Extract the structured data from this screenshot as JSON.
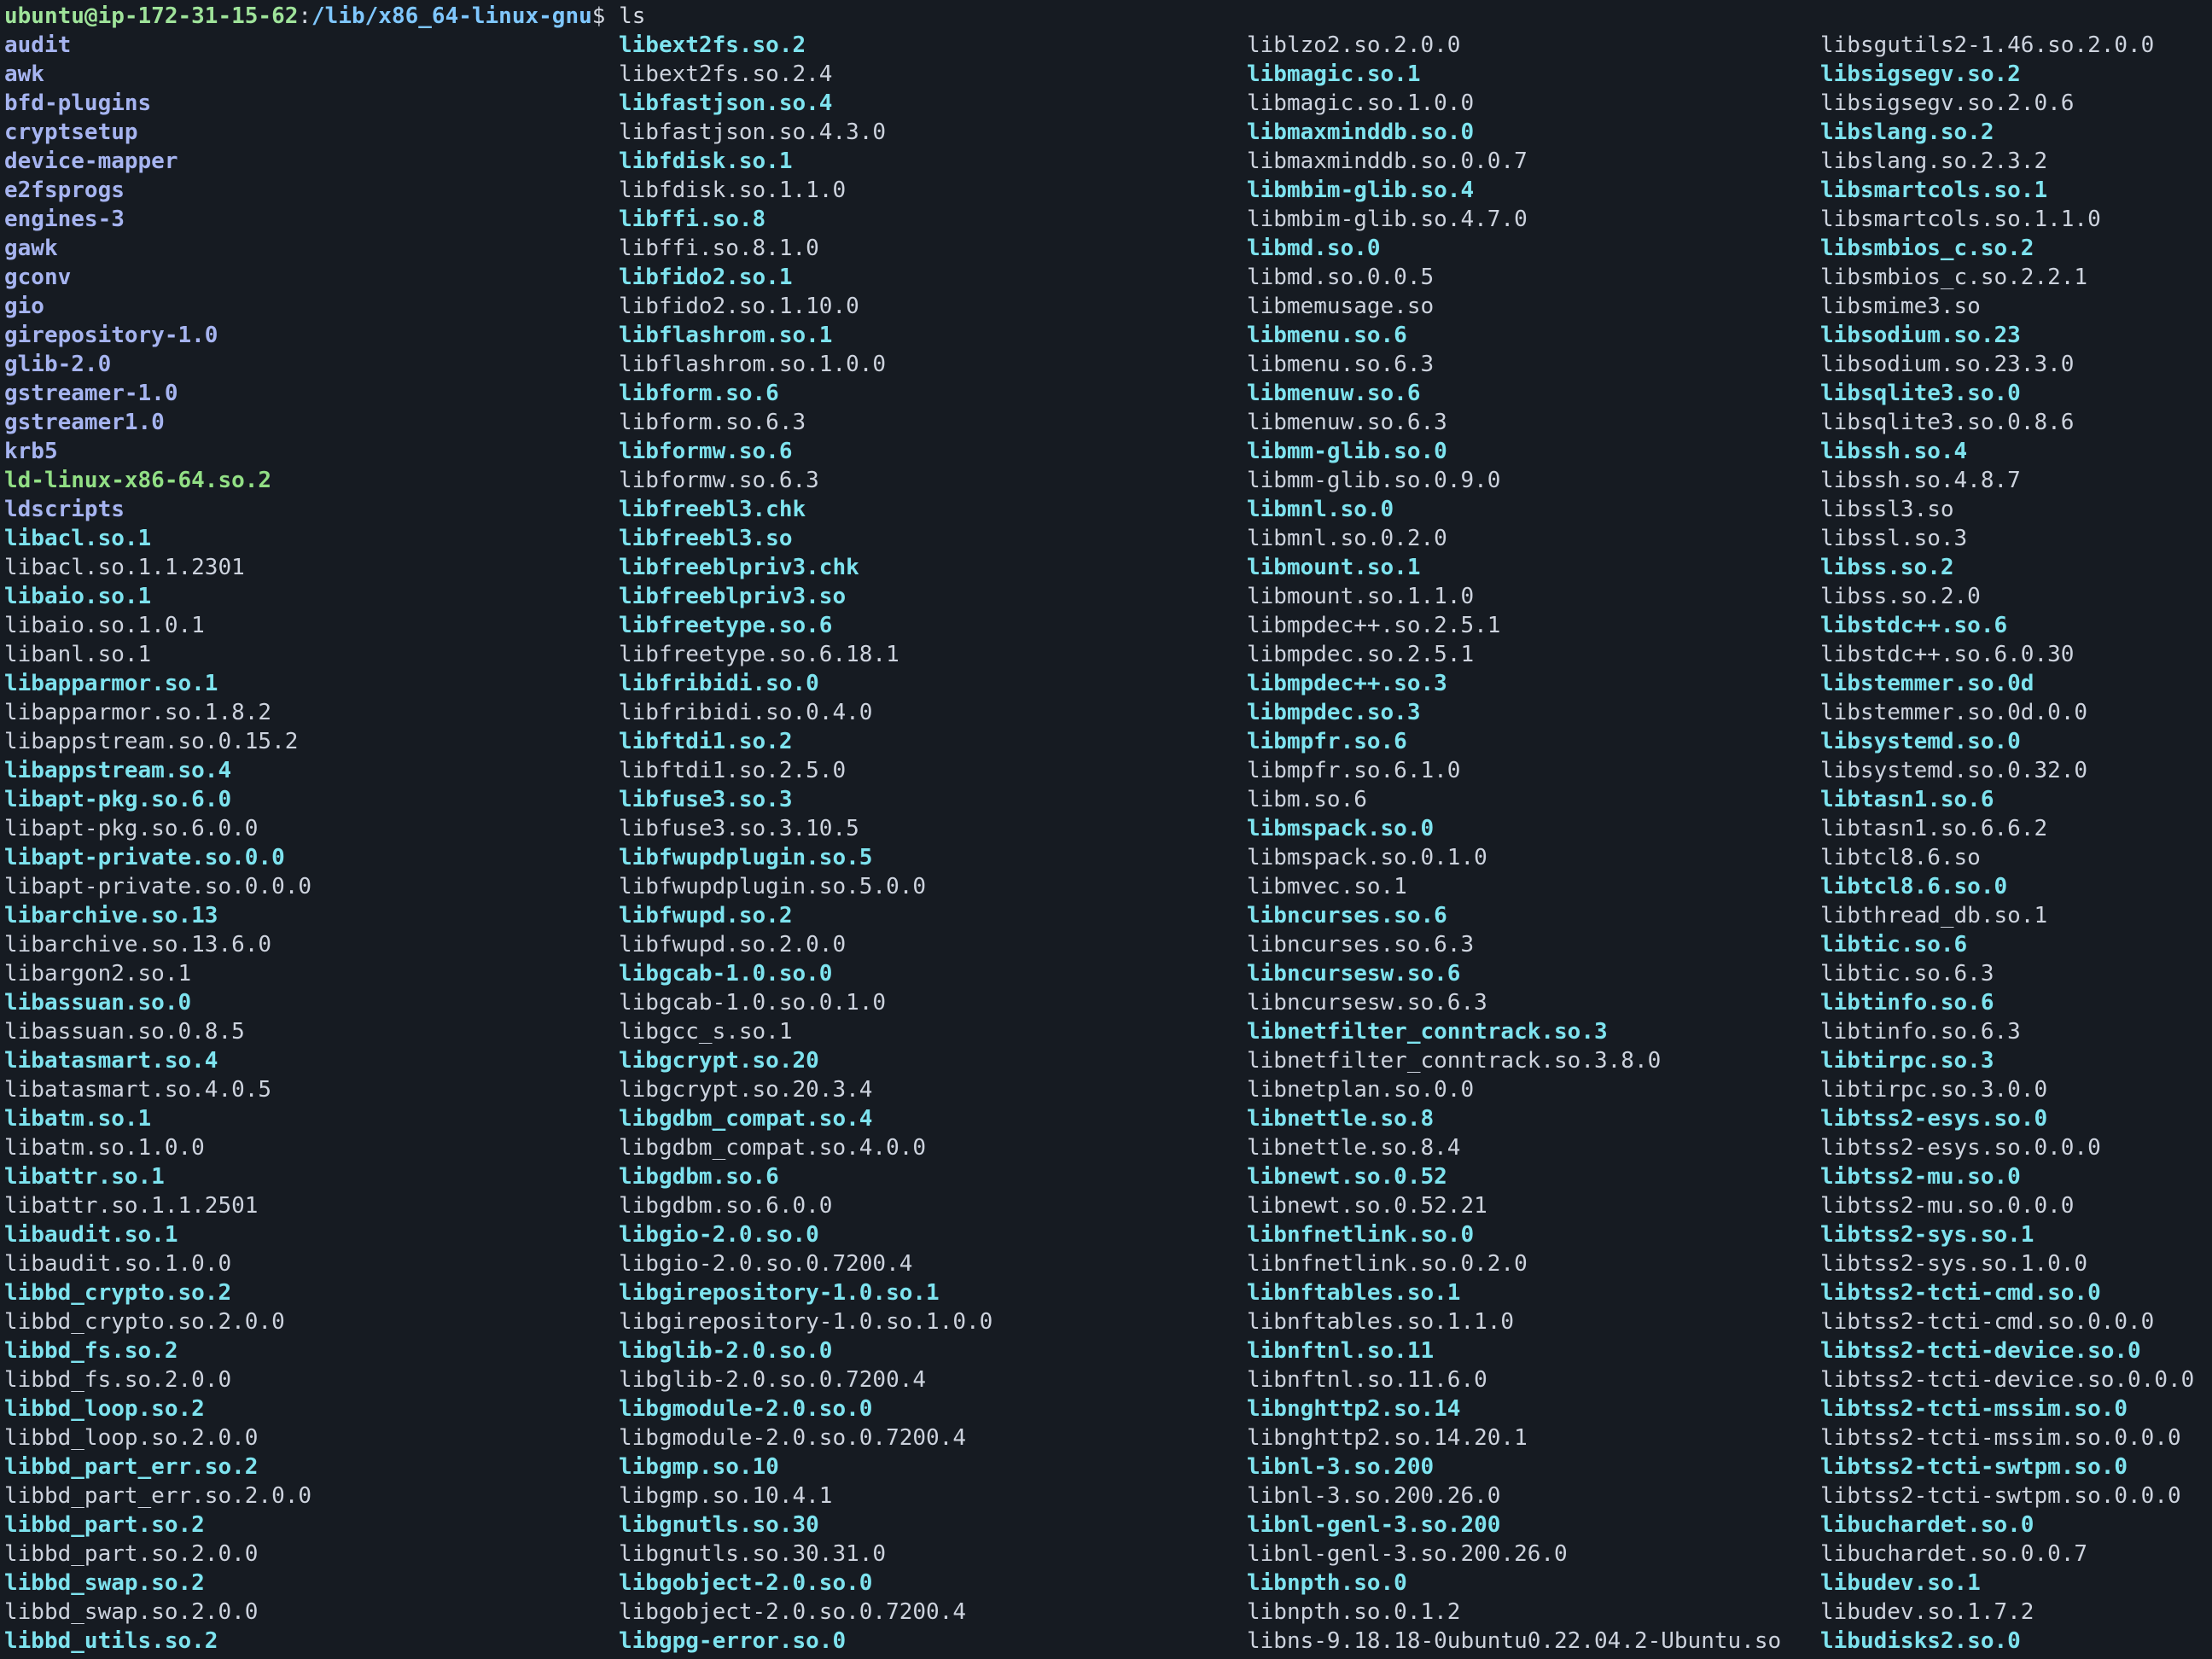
{
  "prompt": {
    "user_host": "ubuntu@ip-172-31-15-62",
    "separator": ":",
    "path": "/lib/x86_64-linux-gnu",
    "symbol": "$ ",
    "command": "ls"
  },
  "colors": {
    "background": "#161b22",
    "directory": "#a6b4f0",
    "symlink": "#7ee3ef",
    "executable": "#92df85",
    "regular_file": "#cdd3de",
    "prompt_user": "#9fe39a",
    "prompt_path": "#7fc7ff"
  },
  "columns": [
    [
      {
        "name": "audit",
        "kind": "dir"
      },
      {
        "name": "awk",
        "kind": "dir"
      },
      {
        "name": "bfd-plugins",
        "kind": "dir"
      },
      {
        "name": "cryptsetup",
        "kind": "dir"
      },
      {
        "name": "device-mapper",
        "kind": "dir"
      },
      {
        "name": "e2fsprogs",
        "kind": "dir"
      },
      {
        "name": "engines-3",
        "kind": "dir"
      },
      {
        "name": "gawk",
        "kind": "dir"
      },
      {
        "name": "gconv",
        "kind": "dir"
      },
      {
        "name": "gio",
        "kind": "dir"
      },
      {
        "name": "girepository-1.0",
        "kind": "dir"
      },
      {
        "name": "glib-2.0",
        "kind": "dir"
      },
      {
        "name": "gstreamer-1.0",
        "kind": "dir"
      },
      {
        "name": "gstreamer1.0",
        "kind": "dir"
      },
      {
        "name": "krb5",
        "kind": "dir"
      },
      {
        "name": "ld-linux-x86-64.so.2",
        "kind": "exec"
      },
      {
        "name": "ldscripts",
        "kind": "dir"
      },
      {
        "name": "libacl.so.1",
        "kind": "link"
      },
      {
        "name": "libacl.so.1.1.2301",
        "kind": "file"
      },
      {
        "name": "libaio.so.1",
        "kind": "link"
      },
      {
        "name": "libaio.so.1.0.1",
        "kind": "file"
      },
      {
        "name": "libanl.so.1",
        "kind": "file"
      },
      {
        "name": "libapparmor.so.1",
        "kind": "link"
      },
      {
        "name": "libapparmor.so.1.8.2",
        "kind": "file"
      },
      {
        "name": "libappstream.so.0.15.2",
        "kind": "file"
      },
      {
        "name": "libappstream.so.4",
        "kind": "link"
      },
      {
        "name": "libapt-pkg.so.6.0",
        "kind": "link"
      },
      {
        "name": "libapt-pkg.so.6.0.0",
        "kind": "file"
      },
      {
        "name": "libapt-private.so.0.0",
        "kind": "link"
      },
      {
        "name": "libapt-private.so.0.0.0",
        "kind": "file"
      },
      {
        "name": "libarchive.so.13",
        "kind": "link"
      },
      {
        "name": "libarchive.so.13.6.0",
        "kind": "file"
      },
      {
        "name": "libargon2.so.1",
        "kind": "file"
      },
      {
        "name": "libassuan.so.0",
        "kind": "link"
      },
      {
        "name": "libassuan.so.0.8.5",
        "kind": "file"
      },
      {
        "name": "libatasmart.so.4",
        "kind": "link"
      },
      {
        "name": "libatasmart.so.4.0.5",
        "kind": "file"
      },
      {
        "name": "libatm.so.1",
        "kind": "link"
      },
      {
        "name": "libatm.so.1.0.0",
        "kind": "file"
      },
      {
        "name": "libattr.so.1",
        "kind": "link"
      },
      {
        "name": "libattr.so.1.1.2501",
        "kind": "file"
      },
      {
        "name": "libaudit.so.1",
        "kind": "link"
      },
      {
        "name": "libaudit.so.1.0.0",
        "kind": "file"
      },
      {
        "name": "libbd_crypto.so.2",
        "kind": "link"
      },
      {
        "name": "libbd_crypto.so.2.0.0",
        "kind": "file"
      },
      {
        "name": "libbd_fs.so.2",
        "kind": "link"
      },
      {
        "name": "libbd_fs.so.2.0.0",
        "kind": "file"
      },
      {
        "name": "libbd_loop.so.2",
        "kind": "link"
      },
      {
        "name": "libbd_loop.so.2.0.0",
        "kind": "file"
      },
      {
        "name": "libbd_part_err.so.2",
        "kind": "link"
      },
      {
        "name": "libbd_part_err.so.2.0.0",
        "kind": "file"
      },
      {
        "name": "libbd_part.so.2",
        "kind": "link"
      },
      {
        "name": "libbd_part.so.2.0.0",
        "kind": "file"
      },
      {
        "name": "libbd_swap.so.2",
        "kind": "link"
      },
      {
        "name": "libbd_swap.so.2.0.0",
        "kind": "file"
      },
      {
        "name": "libbd_utils.so.2",
        "kind": "link"
      }
    ],
    [
      {
        "name": "libext2fs.so.2",
        "kind": "link"
      },
      {
        "name": "libext2fs.so.2.4",
        "kind": "file"
      },
      {
        "name": "libfastjson.so.4",
        "kind": "link"
      },
      {
        "name": "libfastjson.so.4.3.0",
        "kind": "file"
      },
      {
        "name": "libfdisk.so.1",
        "kind": "link"
      },
      {
        "name": "libfdisk.so.1.1.0",
        "kind": "file"
      },
      {
        "name": "libffi.so.8",
        "kind": "link"
      },
      {
        "name": "libffi.so.8.1.0",
        "kind": "file"
      },
      {
        "name": "libfido2.so.1",
        "kind": "link"
      },
      {
        "name": "libfido2.so.1.10.0",
        "kind": "file"
      },
      {
        "name": "libflashrom.so.1",
        "kind": "link"
      },
      {
        "name": "libflashrom.so.1.0.0",
        "kind": "file"
      },
      {
        "name": "libform.so.6",
        "kind": "link"
      },
      {
        "name": "libform.so.6.3",
        "kind": "file"
      },
      {
        "name": "libformw.so.6",
        "kind": "link"
      },
      {
        "name": "libformw.so.6.3",
        "kind": "file"
      },
      {
        "name": "libfreebl3.chk",
        "kind": "link"
      },
      {
        "name": "libfreebl3.so",
        "kind": "link"
      },
      {
        "name": "libfreeblpriv3.chk",
        "kind": "link"
      },
      {
        "name": "libfreeblpriv3.so",
        "kind": "link"
      },
      {
        "name": "libfreetype.so.6",
        "kind": "link"
      },
      {
        "name": "libfreetype.so.6.18.1",
        "kind": "file"
      },
      {
        "name": "libfribidi.so.0",
        "kind": "link"
      },
      {
        "name": "libfribidi.so.0.4.0",
        "kind": "file"
      },
      {
        "name": "libftdi1.so.2",
        "kind": "link"
      },
      {
        "name": "libftdi1.so.2.5.0",
        "kind": "file"
      },
      {
        "name": "libfuse3.so.3",
        "kind": "link"
      },
      {
        "name": "libfuse3.so.3.10.5",
        "kind": "file"
      },
      {
        "name": "libfwupdplugin.so.5",
        "kind": "link"
      },
      {
        "name": "libfwupdplugin.so.5.0.0",
        "kind": "file"
      },
      {
        "name": "libfwupd.so.2",
        "kind": "link"
      },
      {
        "name": "libfwupd.so.2.0.0",
        "kind": "file"
      },
      {
        "name": "libgcab-1.0.so.0",
        "kind": "link"
      },
      {
        "name": "libgcab-1.0.so.0.1.0",
        "kind": "file"
      },
      {
        "name": "libgcc_s.so.1",
        "kind": "file"
      },
      {
        "name": "libgcrypt.so.20",
        "kind": "link"
      },
      {
        "name": "libgcrypt.so.20.3.4",
        "kind": "file"
      },
      {
        "name": "libgdbm_compat.so.4",
        "kind": "link"
      },
      {
        "name": "libgdbm_compat.so.4.0.0",
        "kind": "file"
      },
      {
        "name": "libgdbm.so.6",
        "kind": "link"
      },
      {
        "name": "libgdbm.so.6.0.0",
        "kind": "file"
      },
      {
        "name": "libgio-2.0.so.0",
        "kind": "link"
      },
      {
        "name": "libgio-2.0.so.0.7200.4",
        "kind": "file"
      },
      {
        "name": "libgirepository-1.0.so.1",
        "kind": "link"
      },
      {
        "name": "libgirepository-1.0.so.1.0.0",
        "kind": "file"
      },
      {
        "name": "libglib-2.0.so.0",
        "kind": "link"
      },
      {
        "name": "libglib-2.0.so.0.7200.4",
        "kind": "file"
      },
      {
        "name": "libgmodule-2.0.so.0",
        "kind": "link"
      },
      {
        "name": "libgmodule-2.0.so.0.7200.4",
        "kind": "file"
      },
      {
        "name": "libgmp.so.10",
        "kind": "link"
      },
      {
        "name": "libgmp.so.10.4.1",
        "kind": "file"
      },
      {
        "name": "libgnutls.so.30",
        "kind": "link"
      },
      {
        "name": "libgnutls.so.30.31.0",
        "kind": "file"
      },
      {
        "name": "libgobject-2.0.so.0",
        "kind": "link"
      },
      {
        "name": "libgobject-2.0.so.0.7200.4",
        "kind": "file"
      },
      {
        "name": "libgpg-error.so.0",
        "kind": "link"
      }
    ],
    [
      {
        "name": "liblzo2.so.2.0.0",
        "kind": "file"
      },
      {
        "name": "libmagic.so.1",
        "kind": "link"
      },
      {
        "name": "libmagic.so.1.0.0",
        "kind": "file"
      },
      {
        "name": "libmaxminddb.so.0",
        "kind": "link"
      },
      {
        "name": "libmaxminddb.so.0.0.7",
        "kind": "file"
      },
      {
        "name": "libmbim-glib.so.4",
        "kind": "link"
      },
      {
        "name": "libmbim-glib.so.4.7.0",
        "kind": "file"
      },
      {
        "name": "libmd.so.0",
        "kind": "link"
      },
      {
        "name": "libmd.so.0.0.5",
        "kind": "file"
      },
      {
        "name": "libmemusage.so",
        "kind": "file"
      },
      {
        "name": "libmenu.so.6",
        "kind": "link"
      },
      {
        "name": "libmenu.so.6.3",
        "kind": "file"
      },
      {
        "name": "libmenuw.so.6",
        "kind": "link"
      },
      {
        "name": "libmenuw.so.6.3",
        "kind": "file"
      },
      {
        "name": "libmm-glib.so.0",
        "kind": "link"
      },
      {
        "name": "libmm-glib.so.0.9.0",
        "kind": "file"
      },
      {
        "name": "libmnl.so.0",
        "kind": "link"
      },
      {
        "name": "libmnl.so.0.2.0",
        "kind": "file"
      },
      {
        "name": "libmount.so.1",
        "kind": "link"
      },
      {
        "name": "libmount.so.1.1.0",
        "kind": "file"
      },
      {
        "name": "libmpdec++.so.2.5.1",
        "kind": "file"
      },
      {
        "name": "libmpdec.so.2.5.1",
        "kind": "file"
      },
      {
        "name": "libmpdec++.so.3",
        "kind": "link"
      },
      {
        "name": "libmpdec.so.3",
        "kind": "link"
      },
      {
        "name": "libmpfr.so.6",
        "kind": "link"
      },
      {
        "name": "libmpfr.so.6.1.0",
        "kind": "file"
      },
      {
        "name": "libm.so.6",
        "kind": "file"
      },
      {
        "name": "libmspack.so.0",
        "kind": "link"
      },
      {
        "name": "libmspack.so.0.1.0",
        "kind": "file"
      },
      {
        "name": "libmvec.so.1",
        "kind": "file"
      },
      {
        "name": "libncurses.so.6",
        "kind": "link"
      },
      {
        "name": "libncurses.so.6.3",
        "kind": "file"
      },
      {
        "name": "libncursesw.so.6",
        "kind": "link"
      },
      {
        "name": "libncursesw.so.6.3",
        "kind": "file"
      },
      {
        "name": "libnetfilter_conntrack.so.3",
        "kind": "link"
      },
      {
        "name": "libnetfilter_conntrack.so.3.8.0",
        "kind": "file"
      },
      {
        "name": "libnetplan.so.0.0",
        "kind": "file"
      },
      {
        "name": "libnettle.so.8",
        "kind": "link"
      },
      {
        "name": "libnettle.so.8.4",
        "kind": "file"
      },
      {
        "name": "libnewt.so.0.52",
        "kind": "link"
      },
      {
        "name": "libnewt.so.0.52.21",
        "kind": "file"
      },
      {
        "name": "libnfnetlink.so.0",
        "kind": "link"
      },
      {
        "name": "libnfnetlink.so.0.2.0",
        "kind": "file"
      },
      {
        "name": "libnftables.so.1",
        "kind": "link"
      },
      {
        "name": "libnftables.so.1.1.0",
        "kind": "file"
      },
      {
        "name": "libnftnl.so.11",
        "kind": "link"
      },
      {
        "name": "libnftnl.so.11.6.0",
        "kind": "file"
      },
      {
        "name": "libnghttp2.so.14",
        "kind": "link"
      },
      {
        "name": "libnghttp2.so.14.20.1",
        "kind": "file"
      },
      {
        "name": "libnl-3.so.200",
        "kind": "link"
      },
      {
        "name": "libnl-3.so.200.26.0",
        "kind": "file"
      },
      {
        "name": "libnl-genl-3.so.200",
        "kind": "link"
      },
      {
        "name": "libnl-genl-3.so.200.26.0",
        "kind": "file"
      },
      {
        "name": "libnpth.so.0",
        "kind": "link"
      },
      {
        "name": "libnpth.so.0.1.2",
        "kind": "file"
      },
      {
        "name": "libns-9.18.18-0ubuntu0.22.04.2-Ubuntu.so",
        "kind": "file"
      }
    ],
    [
      {
        "name": "libsgutils2-1.46.so.2.0.0",
        "kind": "file"
      },
      {
        "name": "libsigsegv.so.2",
        "kind": "link"
      },
      {
        "name": "libsigsegv.so.2.0.6",
        "kind": "file"
      },
      {
        "name": "libslang.so.2",
        "kind": "link"
      },
      {
        "name": "libslang.so.2.3.2",
        "kind": "file"
      },
      {
        "name": "libsmartcols.so.1",
        "kind": "link"
      },
      {
        "name": "libsmartcols.so.1.1.0",
        "kind": "file"
      },
      {
        "name": "libsmbios_c.so.2",
        "kind": "link"
      },
      {
        "name": "libsmbios_c.so.2.2.1",
        "kind": "file"
      },
      {
        "name": "libsmime3.so",
        "kind": "file"
      },
      {
        "name": "libsodium.so.23",
        "kind": "link"
      },
      {
        "name": "libsodium.so.23.3.0",
        "kind": "file"
      },
      {
        "name": "libsqlite3.so.0",
        "kind": "link"
      },
      {
        "name": "libsqlite3.so.0.8.6",
        "kind": "file"
      },
      {
        "name": "libssh.so.4",
        "kind": "link"
      },
      {
        "name": "libssh.so.4.8.7",
        "kind": "file"
      },
      {
        "name": "libssl3.so",
        "kind": "file"
      },
      {
        "name": "libssl.so.3",
        "kind": "file"
      },
      {
        "name": "libss.so.2",
        "kind": "link"
      },
      {
        "name": "libss.so.2.0",
        "kind": "file"
      },
      {
        "name": "libstdc++.so.6",
        "kind": "link"
      },
      {
        "name": "libstdc++.so.6.0.30",
        "kind": "file"
      },
      {
        "name": "libstemmer.so.0d",
        "kind": "link"
      },
      {
        "name": "libstemmer.so.0d.0.0",
        "kind": "file"
      },
      {
        "name": "libsystemd.so.0",
        "kind": "link"
      },
      {
        "name": "libsystemd.so.0.32.0",
        "kind": "file"
      },
      {
        "name": "libtasn1.so.6",
        "kind": "link"
      },
      {
        "name": "libtasn1.so.6.6.2",
        "kind": "file"
      },
      {
        "name": "libtcl8.6.so",
        "kind": "file"
      },
      {
        "name": "libtcl8.6.so.0",
        "kind": "link"
      },
      {
        "name": "libthread_db.so.1",
        "kind": "file"
      },
      {
        "name": "libtic.so.6",
        "kind": "link"
      },
      {
        "name": "libtic.so.6.3",
        "kind": "file"
      },
      {
        "name": "libtinfo.so.6",
        "kind": "link"
      },
      {
        "name": "libtinfo.so.6.3",
        "kind": "file"
      },
      {
        "name": "libtirpc.so.3",
        "kind": "link"
      },
      {
        "name": "libtirpc.so.3.0.0",
        "kind": "file"
      },
      {
        "name": "libtss2-esys.so.0",
        "kind": "link"
      },
      {
        "name": "libtss2-esys.so.0.0.0",
        "kind": "file"
      },
      {
        "name": "libtss2-mu.so.0",
        "kind": "link"
      },
      {
        "name": "libtss2-mu.so.0.0.0",
        "kind": "file"
      },
      {
        "name": "libtss2-sys.so.1",
        "kind": "link"
      },
      {
        "name": "libtss2-sys.so.1.0.0",
        "kind": "file"
      },
      {
        "name": "libtss2-tcti-cmd.so.0",
        "kind": "link"
      },
      {
        "name": "libtss2-tcti-cmd.so.0.0.0",
        "kind": "file"
      },
      {
        "name": "libtss2-tcti-device.so.0",
        "kind": "link"
      },
      {
        "name": "libtss2-tcti-device.so.0.0.0",
        "kind": "file"
      },
      {
        "name": "libtss2-tcti-mssim.so.0",
        "kind": "link"
      },
      {
        "name": "libtss2-tcti-mssim.so.0.0.0",
        "kind": "file"
      },
      {
        "name": "libtss2-tcti-swtpm.so.0",
        "kind": "link"
      },
      {
        "name": "libtss2-tcti-swtpm.so.0.0.0",
        "kind": "file"
      },
      {
        "name": "libuchardet.so.0",
        "kind": "link"
      },
      {
        "name": "libuchardet.so.0.0.7",
        "kind": "file"
      },
      {
        "name": "libudev.so.1",
        "kind": "link"
      },
      {
        "name": "libudev.so.1.7.2",
        "kind": "file"
      },
      {
        "name": "libudisks2.so.0",
        "kind": "link"
      }
    ]
  ]
}
